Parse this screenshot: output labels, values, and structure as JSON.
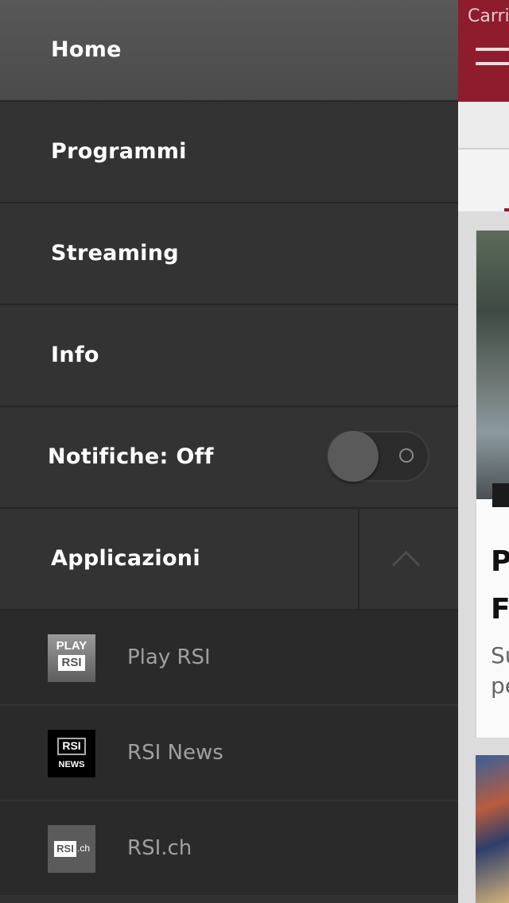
{
  "background_app": {
    "carrier": "Carri",
    "headline_partial_1": "P",
    "headline_partial_2": "F",
    "subtitle_partial_1": "Su",
    "subtitle_partial_2": "pe"
  },
  "menu": {
    "items": [
      {
        "label": "Home",
        "active": true
      },
      {
        "label": "Programmi"
      },
      {
        "label": "Streaming"
      },
      {
        "label": "Info"
      }
    ],
    "notifications": {
      "label": "Notifiche: Off",
      "enabled": false
    },
    "apps": {
      "label": "Applicazioni",
      "expanded": true,
      "items": [
        {
          "label": "Play RSI",
          "logo_text_top": "PLAY",
          "logo_text_bottom": "RSI"
        },
        {
          "label": "RSI News",
          "logo_text_top": "RSI",
          "logo_text_bottom": "NEWS"
        },
        {
          "label": "RSI.ch",
          "logo_text_top": "RSI",
          "logo_text_bottom": ".ch"
        }
      ]
    }
  },
  "colors": {
    "brand_red": "#8e1c2c",
    "menu_bg": "#333333",
    "active_bg": "#4b4b4b"
  }
}
